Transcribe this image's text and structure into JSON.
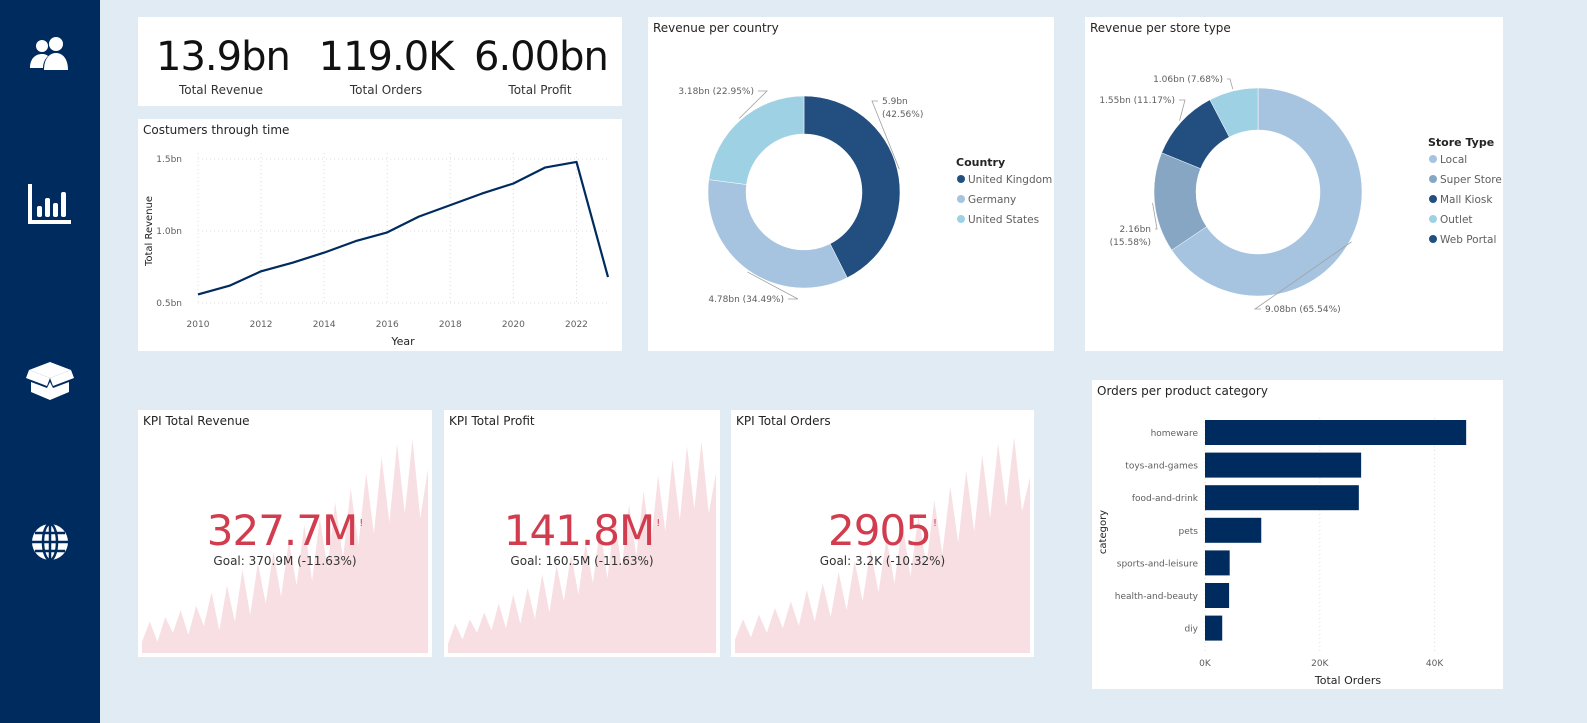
{
  "nav": [
    {
      "icon": "users-icon"
    },
    {
      "icon": "bar-chart-icon"
    },
    {
      "icon": "open-box-icon"
    },
    {
      "icon": "globe-icon"
    }
  ],
  "summary": {
    "items": [
      {
        "value": "13.9bn",
        "label": "Total Revenue"
      },
      {
        "value": "119.0K",
        "label": "Total Orders"
      },
      {
        "value": "6.00bn",
        "label": "Total Profit"
      }
    ]
  },
  "colors": {
    "navy": "#002b5e",
    "uk": "#234f80",
    "germany": "#a6c3e0",
    "us": "#9dd1e3",
    "local": "#a6c3e0",
    "super_store": "#87a6c3",
    "mall_kiosk": "#234f80",
    "outlet": "#9dd1e3",
    "web_portal": "#234f80",
    "kpi_red": "#d13c4e",
    "kpi_area": "#f8dfe3"
  },
  "kpis": [
    {
      "title": "KPI Total Revenue",
      "value": "327.7M",
      "alert": "!",
      "goal": "Goal: 370.9M (-11.63%)"
    },
    {
      "title": "KPI Total Profit",
      "value": "141.8M",
      "alert": "!",
      "goal": "Goal: 160.5M (-11.63%)"
    },
    {
      "title": "KPI Total Orders",
      "value": "2905",
      "alert": "!",
      "goal": "Goal: 3.2K (-10.32%)"
    }
  ],
  "chart_data": [
    {
      "id": "customers",
      "type": "line",
      "title": "Costumers through time",
      "xlabel": "Year",
      "ylabel": "Total Revenue",
      "x": [
        2010,
        2011,
        2012,
        2013,
        2014,
        2015,
        2016,
        2017,
        2018,
        2019,
        2020,
        2021,
        2022,
        2023
      ],
      "values": [
        0.56,
        0.62,
        0.72,
        0.78,
        0.85,
        0.93,
        0.99,
        1.1,
        1.18,
        1.26,
        1.33,
        1.44,
        1.48,
        0.68
      ],
      "xticks": [
        "2010",
        "2012",
        "2014",
        "2016",
        "2018",
        "2020",
        "2022"
      ],
      "yticks": [
        "0.5bn",
        "1.0bn",
        "1.5bn"
      ],
      "xlim": [
        2010,
        2023
      ],
      "ylim": [
        0.5,
        1.5
      ],
      "grid": true
    },
    {
      "id": "country",
      "type": "pie",
      "title": "Revenue per country",
      "legend_title": "Country",
      "legend_position": "right",
      "slices": [
        {
          "name": "United Kingdom",
          "value": 5.9,
          "label": "5.9bn",
          "label2": "(42.56%)"
        },
        {
          "name": "Germany",
          "value": 4.78,
          "label": "4.78bn (34.49%)"
        },
        {
          "name": "United States",
          "value": 3.18,
          "label": "3.18bn (22.95%)"
        }
      ]
    },
    {
      "id": "store",
      "type": "pie",
      "title": "Revenue per store type",
      "legend_title": "Store Type",
      "legend_position": "right",
      "legend": [
        "Local",
        "Super Store",
        "Mall Kiosk",
        "Outlet",
        "Web Portal"
      ],
      "slices": [
        {
          "name": "Local",
          "value": 9.08,
          "label": "9.08bn (65.54%)"
        },
        {
          "name": "Super Store",
          "value": 2.16,
          "label": "2.16bn",
          "label2": "(15.58%)"
        },
        {
          "name": "Mall Kiosk",
          "value": 1.55,
          "label": "1.55bn (11.17%)"
        },
        {
          "name": "Outlet",
          "value": 1.06,
          "label": "1.06bn (7.68%)"
        }
      ]
    },
    {
      "id": "category",
      "type": "bar",
      "orientation": "horizontal",
      "title": "Orders per product category",
      "xlabel": "Total Orders",
      "ylabel": "category",
      "categories": [
        "homeware",
        "toys-and-games",
        "food-and-drink",
        "pets",
        "sports-and-leisure",
        "health-and-beauty",
        "diy"
      ],
      "values": [
        45500,
        27200,
        26800,
        9800,
        4300,
        4200,
        3000
      ],
      "xticks": [
        "0K",
        "20K",
        "40K"
      ],
      "xlim": [
        0,
        50000
      ],
      "grid": true
    },
    {
      "id": "kpi-revenue-trend",
      "type": "area",
      "values": [
        0.05,
        0.14,
        0.05,
        0.16,
        0.09,
        0.19,
        0.08,
        0.21,
        0.12,
        0.27,
        0.1,
        0.3,
        0.14,
        0.37,
        0.17,
        0.4,
        0.22,
        0.45,
        0.25,
        0.5,
        0.3,
        0.57,
        0.32,
        0.6,
        0.38,
        0.67,
        0.42,
        0.73,
        0.48,
        0.8,
        0.53,
        0.87,
        0.58,
        0.93,
        0.62,
        0.95,
        0.6,
        0.82
      ]
    },
    {
      "id": "kpi-profit-trend",
      "type": "area",
      "values": [
        0.04,
        0.13,
        0.06,
        0.15,
        0.09,
        0.18,
        0.1,
        0.22,
        0.11,
        0.26,
        0.13,
        0.29,
        0.15,
        0.35,
        0.18,
        0.39,
        0.23,
        0.44,
        0.26,
        0.49,
        0.31,
        0.56,
        0.33,
        0.6,
        0.38,
        0.66,
        0.43,
        0.72,
        0.48,
        0.79,
        0.54,
        0.86,
        0.59,
        0.92,
        0.64,
        0.94,
        0.62,
        0.8
      ]
    },
    {
      "id": "kpi-orders-trend",
      "type": "area",
      "values": [
        0.06,
        0.15,
        0.07,
        0.17,
        0.09,
        0.2,
        0.11,
        0.23,
        0.12,
        0.28,
        0.14,
        0.31,
        0.16,
        0.36,
        0.19,
        0.41,
        0.23,
        0.46,
        0.27,
        0.51,
        0.31,
        0.58,
        0.34,
        0.61,
        0.39,
        0.68,
        0.44,
        0.74,
        0.49,
        0.81,
        0.54,
        0.88,
        0.6,
        0.93,
        0.65,
        0.96,
        0.63,
        0.78
      ]
    }
  ]
}
